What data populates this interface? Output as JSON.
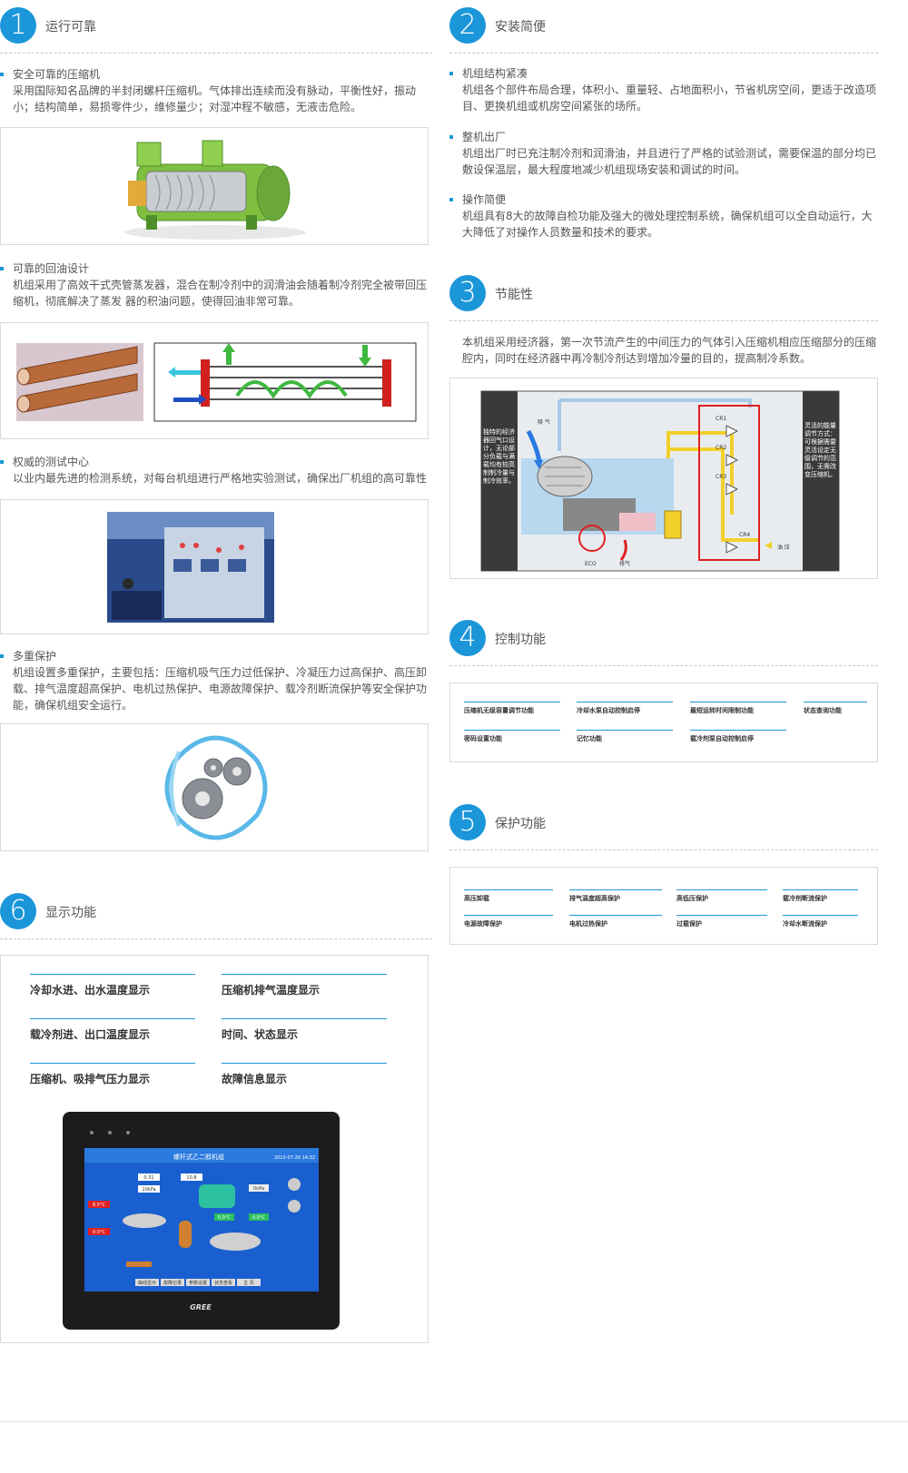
{
  "sections": {
    "s1": {
      "num": "1",
      "title": "运行可靠"
    },
    "s2": {
      "num": "2",
      "title": "安装简便"
    },
    "s3": {
      "num": "3",
      "title": "节能性"
    },
    "s4": {
      "num": "4",
      "title": "控制功能"
    },
    "s5": {
      "num": "5",
      "title": "保护功能"
    },
    "s6": {
      "num": "6",
      "title": "显示功能"
    }
  },
  "reliability": [
    {
      "title": "安全可靠的压缩机",
      "desc": "采用国际知名品牌的半封闭螺杆压缩机。气体排出连续而没有脉动，平衡性好，振动小；结构简单，易损零件少，维修量少；对湿冲程不敏感，无液击危险。"
    },
    {
      "title": "可靠的回油设计",
      "desc": "机组采用了高效干式壳管蒸发器，混合在制冷剂中的润滑油会随着制冷剂完全被带回压缩机，彻底解决了蒸发 器的积油问题，使得回油非常可靠。"
    },
    {
      "title": "权威的测试中心",
      "desc": "以业内最先进的检测系统，对每台机组进行严格地实验测试，确保出厂机组的高可靠性"
    },
    {
      "title": "多重保护",
      "desc": "机组设置多重保护，主要包括：压缩机吸气压力过低保护、冷凝压力过高保护、高压卸载、排气温度超高保护、电机过热保护、电源故障保护、载冷剂断流保护等安全保护功能，确保机组安全运行。"
    }
  ],
  "installation": [
    {
      "title": "机组结构紧凑",
      "desc": "机组各个部件布局合理，体积小、重量轻、占地面积小，节省机房空间，更适于改造项目、更换机组或机房空间紧张的场所。"
    },
    {
      "title": "整机出厂",
      "desc": "机组出厂时已充注制冷剂和润滑油，并且进行了严格的试验测试，需要保温的部分均已敷设保温层，最大程度地减少机组现场安装和调试的时间。"
    },
    {
      "title": "操作简便",
      "desc": "机组具有8大的故障自检功能及强大的微处理控制系统，确保机组可以全自动运行，大大降低了对操作人员数量和技术的要求。"
    }
  ],
  "energy": {
    "desc": "本机组采用经济器，第一次节流产生的中间压力的气体引入压缩机相应压缩部分的压缩腔内，同时在经济器中再冷制冷剂达到增加冷量的目的，提高制冷系数。",
    "diagram": {
      "left_note": "独特的经济器回气口设计，无论部分负载与满载均有较高制制冷量与制冷效率。",
      "right_note": "灵活的能量调节方式：可根据需要灵活设定无级调节的范围，无需改变压缩机。",
      "suction": "吸 气",
      "eco": "ECO",
      "discharge": "排气",
      "oil_pressure": "油 压",
      "valves": [
        "CR1",
        "CR2",
        "CR3",
        "CR4"
      ]
    }
  },
  "control_features": [
    "压缩机无级容量调节功能",
    "冷却水泵自动控制启停",
    "最短运转时间限制功能",
    "状态查询功能",
    "密码设置功能",
    "记忆功能",
    "载冷剂泵自动控制启停"
  ],
  "protection_features": [
    "高压卸载",
    "排气温度超高保护",
    "高低压保护",
    "载冷剂断流保护",
    "电源故障保护",
    "电机过热保护",
    "过载保护",
    "冷却水断流保护"
  ],
  "display_features": [
    "冷却水进、出水温度显示",
    "压缩机排气温度显示",
    "载冷剂进、出口温度显示",
    "时间、状态显示",
    "压缩机、吸排气压力显示",
    "故障信息显示"
  ],
  "hmi": {
    "title": "螺杆式乙二醇机组",
    "datetime": "2010-07-26 14:32",
    "brand": "GREE",
    "readings": [
      "0.31",
      "10.8",
      "10kPa",
      "8.5°C",
      "0.0°C",
      "0.0°C",
      "0.0°C",
      "0nPa"
    ],
    "buttons": [
      "曲线显示",
      "故障记录",
      "参数设置",
      "状态查看",
      "主 页"
    ]
  },
  "colors": {
    "accent": "#1b96d9",
    "frame_red": "#e02020",
    "pipe_yellow": "#f2d02a",
    "pipe_blue": "#a8c8e8"
  }
}
